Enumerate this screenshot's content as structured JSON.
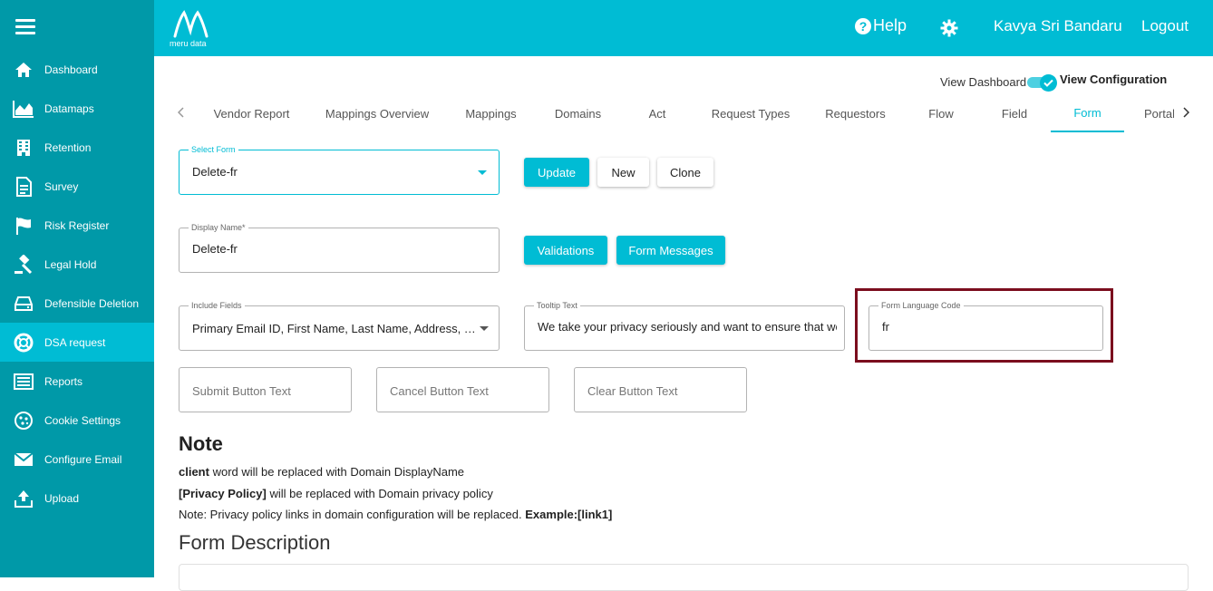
{
  "sidebar": {
    "items": [
      {
        "label": "Dashboard",
        "icon": "home-icon"
      },
      {
        "label": "Datamaps",
        "icon": "area-chart-icon"
      },
      {
        "label": "Retention",
        "icon": "building-icon"
      },
      {
        "label": "Survey",
        "icon": "document-icon"
      },
      {
        "label": "Risk Register",
        "icon": "flag-icon"
      },
      {
        "label": "Legal Hold",
        "icon": "gavel-icon"
      },
      {
        "label": "Defensible Deletion",
        "icon": "drive-icon"
      },
      {
        "label": "DSA request",
        "icon": "lifebuoy-icon"
      },
      {
        "label": "Reports",
        "icon": "list-icon"
      },
      {
        "label": "Cookie Settings",
        "icon": "cookie-icon"
      },
      {
        "label": "Configure Email",
        "icon": "envelope-icon"
      },
      {
        "label": "Upload",
        "icon": "upload-icon"
      }
    ],
    "active": "DSA request"
  },
  "header": {
    "logo_text": "meru data",
    "help_label": "Help",
    "user_name": "Kavya Sri Bandaru",
    "logout_label": "Logout"
  },
  "view_toggle": {
    "left_label": "View Dashboard",
    "right_label": "View Configuration",
    "checked": true
  },
  "tabs": {
    "items": [
      "Vendor Report",
      "Mappings Overview",
      "Mappings",
      "Domains",
      "Act",
      "Request Types",
      "Requestors",
      "Flow",
      "Field",
      "Form",
      "Portal"
    ],
    "active": "Form"
  },
  "form": {
    "select_form": {
      "label": "Select Form",
      "value": "Delete-fr"
    },
    "update_label": "Update",
    "new_label": "New",
    "clone_label": "Clone",
    "display_name": {
      "label": "Display Name*",
      "value": "Delete-fr"
    },
    "validations_label": "Validations",
    "form_messages_label": "Form Messages",
    "include_fields": {
      "label": "Include Fields",
      "value": "Primary Email ID, First Name, Last Name, Address, City,..."
    },
    "tooltip_text": {
      "label": "Tooltip Text",
      "value": "We take your privacy seriously and want to ensure that we"
    },
    "form_language_code": {
      "label": "Form Language Code",
      "value": "fr"
    },
    "submit_button_text": {
      "placeholder": "Submit Button Text"
    },
    "cancel_button_text": {
      "placeholder": "Cancel Button Text"
    },
    "clear_button_text": {
      "placeholder": "Clear Button Text"
    }
  },
  "note": {
    "title": "Note",
    "line1_bold": "client",
    "line1_rest": " word will be replaced with Domain DisplayName",
    "line2_bold": "[Privacy Policy]",
    "line2_rest": " will be replaced with Domain privacy policy",
    "line3_text": "Note: Privacy policy links in domain configuration will be replaced. ",
    "line3_bold": "Example:[link1]"
  },
  "form_description": {
    "title": "Form Description"
  },
  "colors": {
    "accent": "#00bcd4",
    "sidebar": "#0099a8",
    "highlight": "#7b0d1e"
  }
}
